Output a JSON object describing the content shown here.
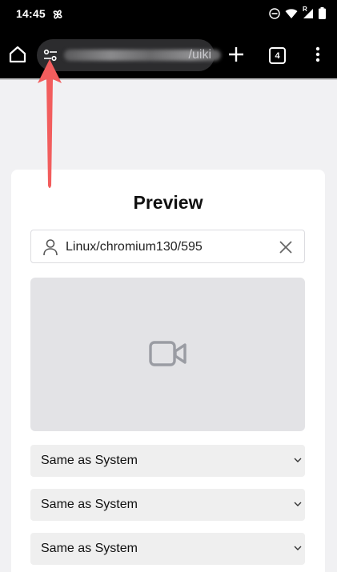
{
  "status_bar": {
    "time": "14:45",
    "icons": [
      "pinwheel-icon",
      "dnd-icon",
      "wifi-icon",
      "signal-icon",
      "battery-icon"
    ],
    "signal_badge": "R"
  },
  "toolbar": {
    "url_visible_suffix": "/uiki",
    "tab_count": "4",
    "icons": [
      "home-icon",
      "site-settings-icon",
      "plus-icon",
      "more-vert-icon"
    ]
  },
  "preview": {
    "title": "Preview",
    "user_field_value": "Linux/chromium130/595",
    "select_1": "Same as System",
    "select_2": "Same as System",
    "select_3": "Same as System"
  },
  "colors": {
    "arrow": "#f25d5d",
    "toolbar_bg": "#000000",
    "page_bg": "#f1f1f3"
  }
}
